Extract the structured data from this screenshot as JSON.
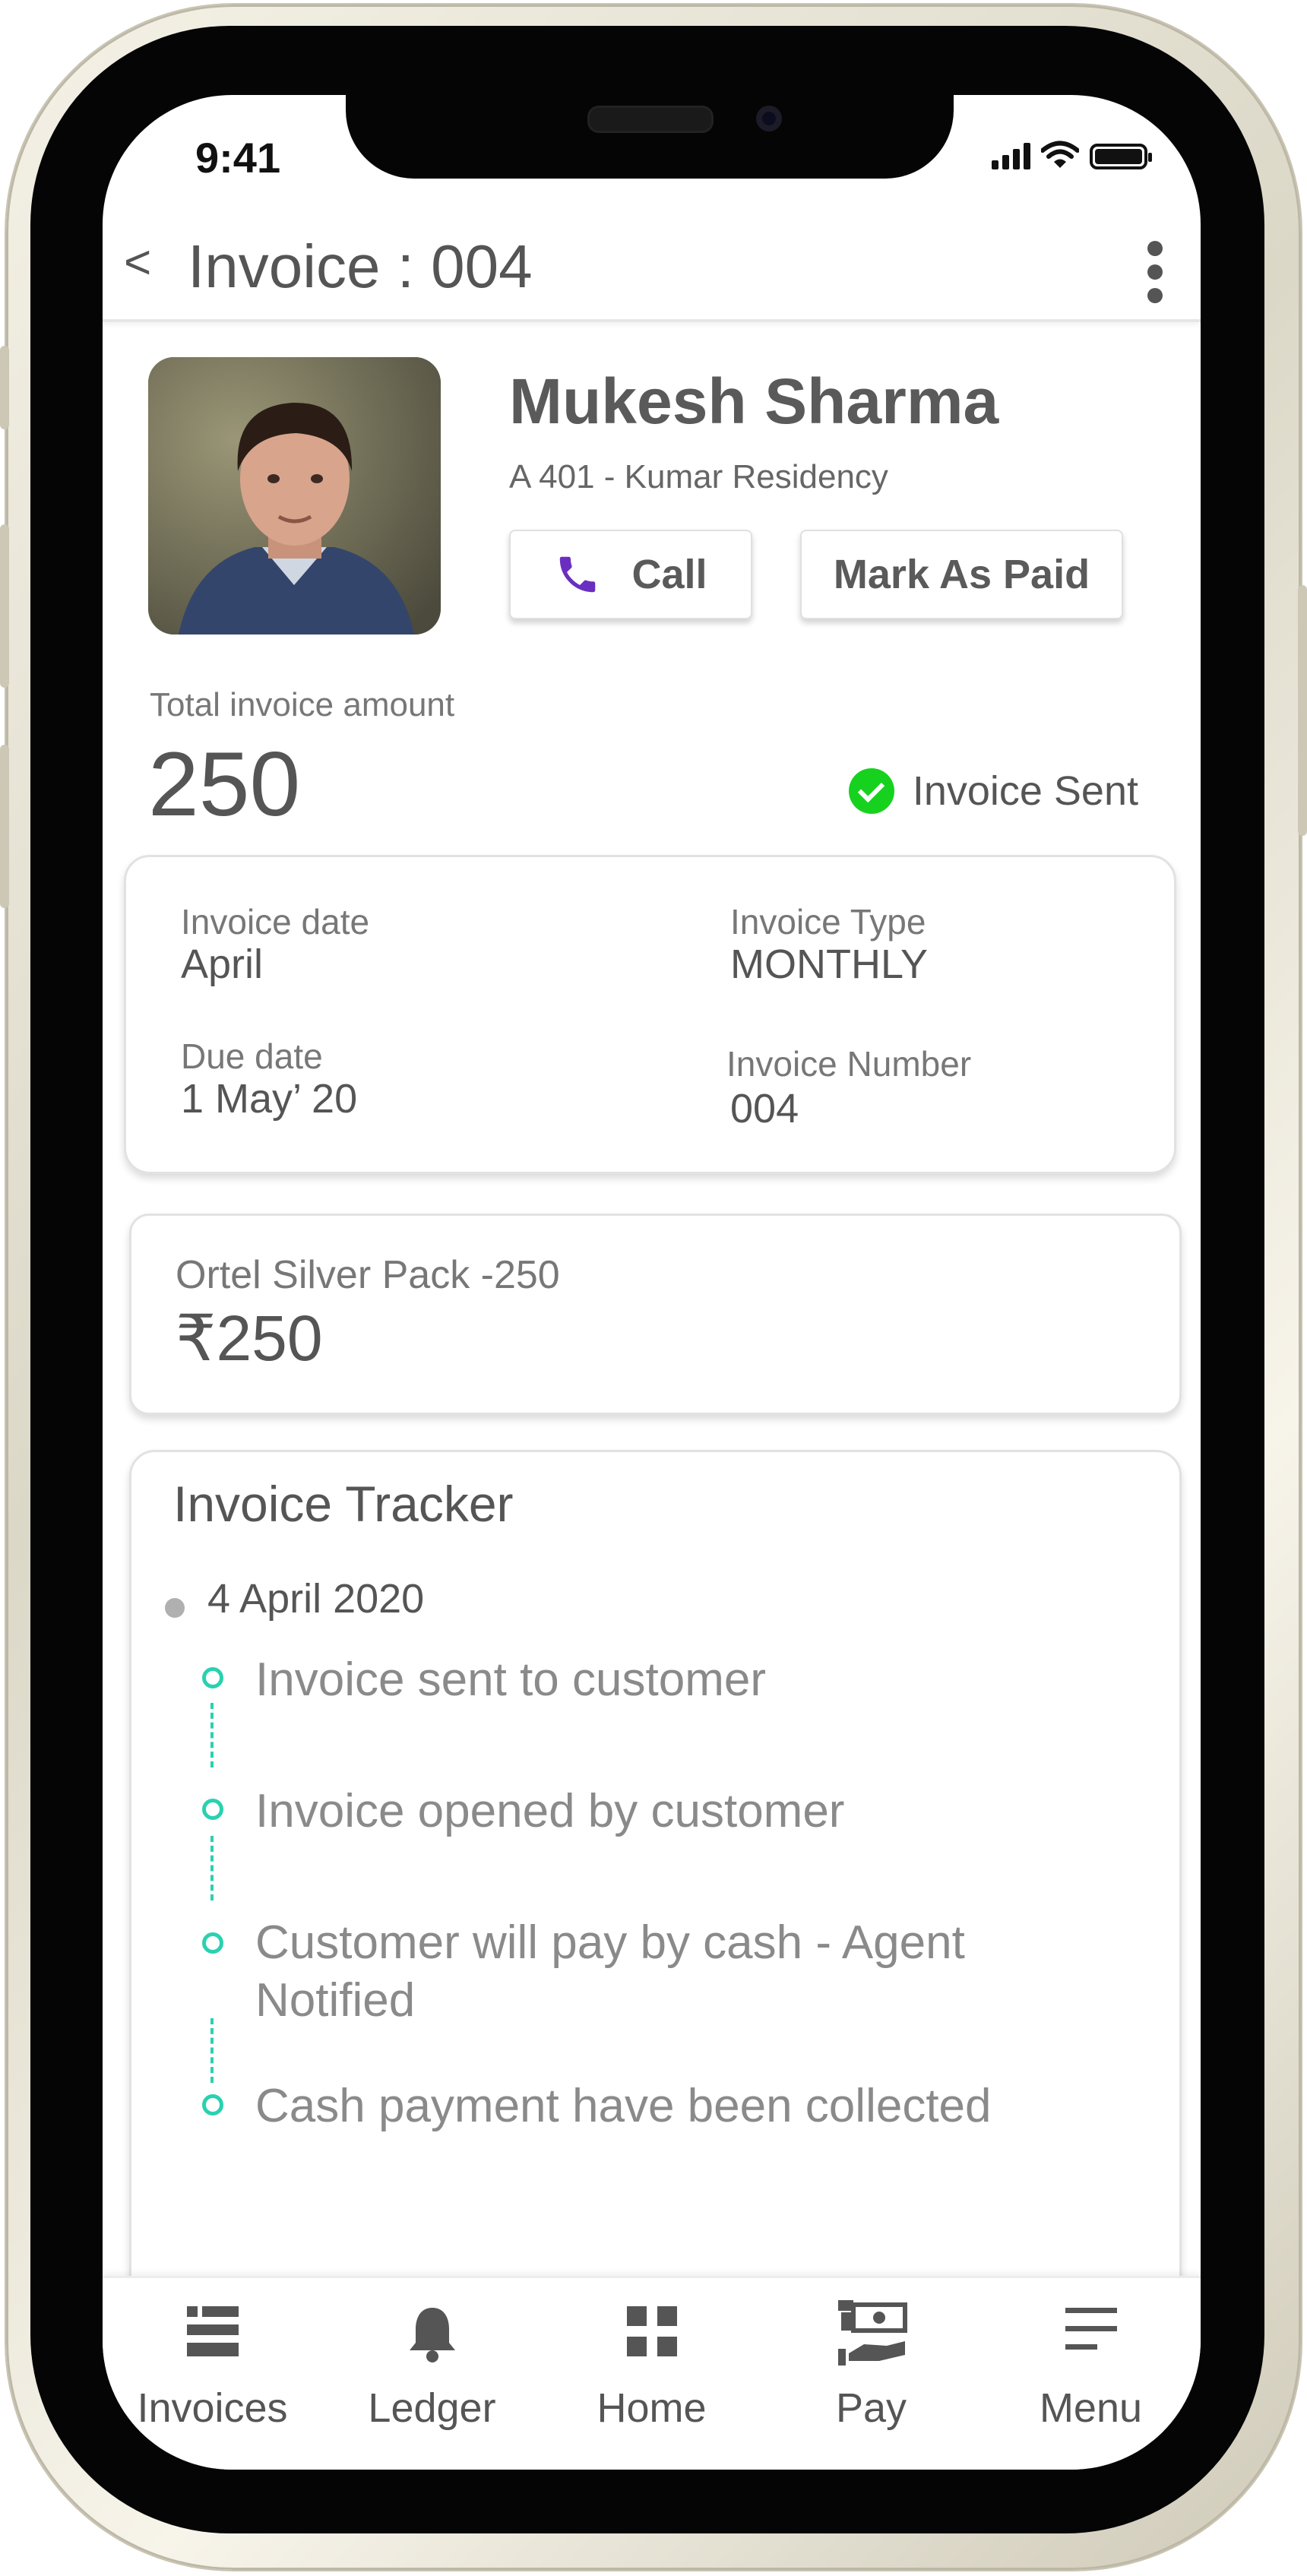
{
  "status_bar": {
    "time": "9:41"
  },
  "header": {
    "back": "<",
    "title": "Invoice : 004"
  },
  "customer": {
    "name": "Mukesh Sharma",
    "address": "A 401 - Kumar Residency"
  },
  "actions": {
    "call_label": "Call",
    "mark_paid_label": "Mark As Paid"
  },
  "total": {
    "label": "Total invoice amount",
    "amount": "250",
    "status": "Invoice Sent",
    "status_color": "#16d21e"
  },
  "details": {
    "invoice_date_label": "Invoice date",
    "invoice_date": "April",
    "invoice_type_label": "Invoice Type",
    "invoice_type": "MONTHLY",
    "due_date_label": "Due date",
    "due_date": "1 May’ 20",
    "invoice_number_label": "Invoice Number",
    "invoice_number": "004"
  },
  "pack": {
    "name": "Ortel Silver Pack -250",
    "price": "₹250"
  },
  "tracker": {
    "title": "Invoice Tracker",
    "date": "4 April 2020",
    "events": [
      "Invoice sent to customer",
      "Invoice opened by customer",
      "Customer will pay by cash - Agent Notified",
      "Cash payment have been collected"
    ],
    "accent_color": "#2ad1b0"
  },
  "nav": {
    "items": [
      {
        "label": "Invoices",
        "icon": "invoices-icon"
      },
      {
        "label": "Ledger",
        "icon": "bell-icon"
      },
      {
        "label": "Home",
        "icon": "home-grid-icon"
      },
      {
        "label": "Pay",
        "icon": "pay-hand-icon"
      },
      {
        "label": "Menu",
        "icon": "menu-icon"
      }
    ]
  },
  "colors": {
    "call_icon": "#6a2fc0",
    "text": "#555555"
  }
}
